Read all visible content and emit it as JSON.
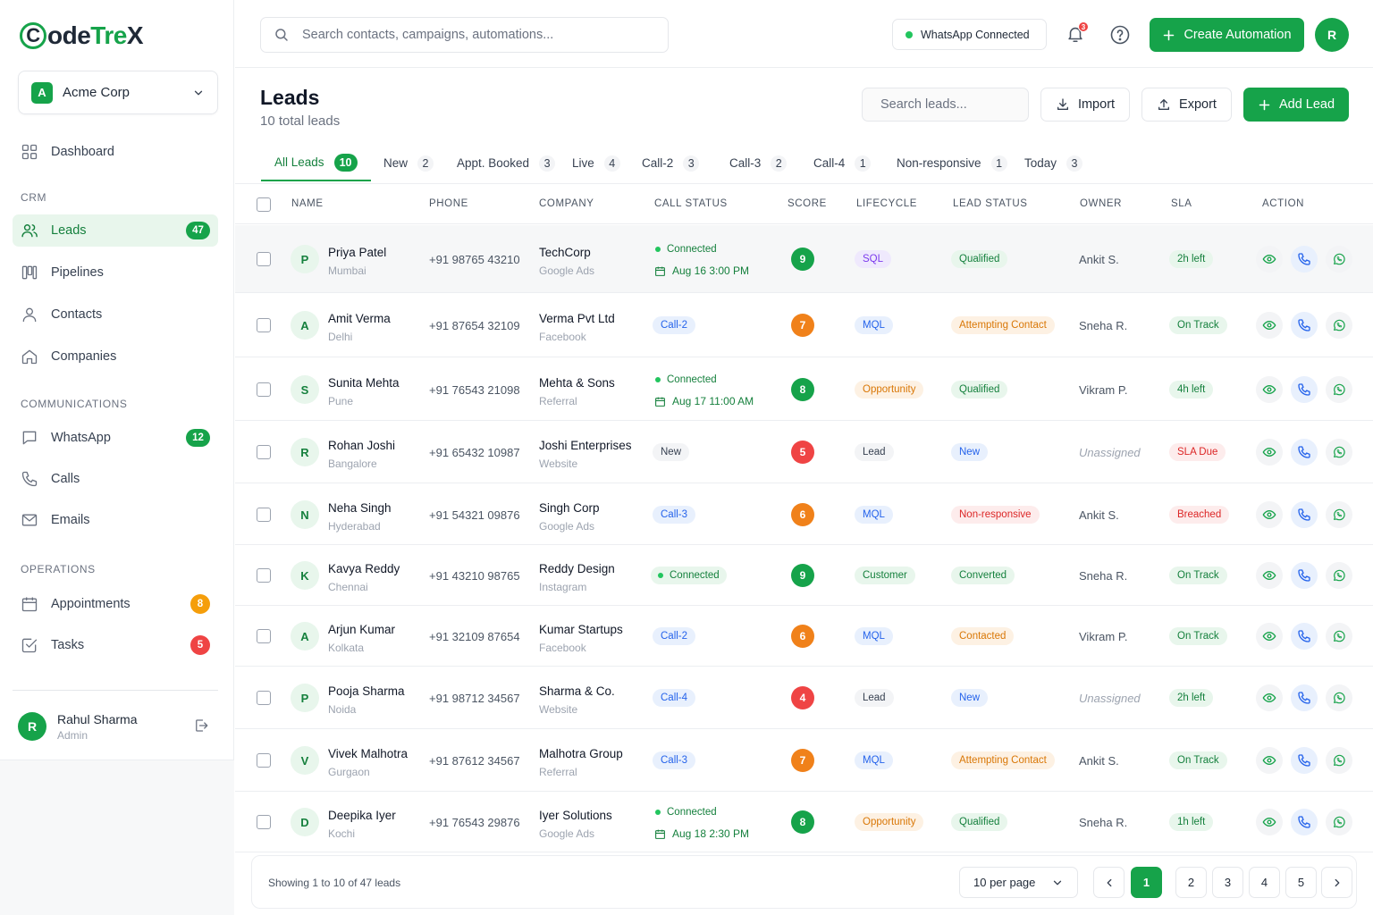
{
  "brand": {
    "part1": "ode",
    "part2": "Tre",
    "part3": "X",
    "ring_letter": "C"
  },
  "org": {
    "initial": "A",
    "name": "Acme Corp"
  },
  "nav": {
    "dashboard": "Dashboard",
    "crm_label": "CRM",
    "leads": "Leads",
    "leads_count": "47",
    "pipelines": "Pipelines",
    "contacts": "Contacts",
    "companies": "Companies",
    "comms_label": "COMMUNICATIONS",
    "whatsapp": "WhatsApp",
    "whatsapp_count": "12",
    "calls": "Calls",
    "emails": "Emails",
    "ops_label": "OPERATIONS",
    "appointments": "Appointments",
    "appointments_count": "8",
    "tasks": "Tasks",
    "tasks_count": "5"
  },
  "user": {
    "initial": "R",
    "name": "Rahul Sharma",
    "role": "Admin"
  },
  "topbar": {
    "search_placeholder": "Search contacts, campaigns, automations...",
    "whatsapp_status": "WhatsApp Connected",
    "notif_count": "3",
    "create_label": "Create Automation",
    "avatar_initial": "R"
  },
  "page": {
    "title": "Leads",
    "subtitle": "10 total leads",
    "search_placeholder": "Search leads...",
    "import_label": "Import",
    "export_label": "Export",
    "add_label": "Add Lead"
  },
  "tabs": [
    {
      "label": "All Leads",
      "count": "10"
    },
    {
      "label": "New",
      "count": "2"
    },
    {
      "label": "Appt. Booked",
      "count": "3"
    },
    {
      "label": "Live",
      "count": "4"
    },
    {
      "label": "Call-2",
      "count": "3"
    },
    {
      "label": "Call-3",
      "count": "2"
    },
    {
      "label": "Call-4",
      "count": "1"
    },
    {
      "label": "Non-responsive",
      "count": "1"
    },
    {
      "label": "Today",
      "count": "3"
    }
  ],
  "columns": [
    "NAME",
    "PHONE",
    "COMPANY",
    "CALL STATUS",
    "SCORE",
    "LIFECYCLE",
    "LEAD STATUS",
    "OWNER",
    "SLA",
    "ACTION"
  ],
  "leads": [
    {
      "initial": "P",
      "name": "Priya Patel",
      "city": "Mumbai",
      "phone": "+91 98765 43210",
      "company": "TechCorp",
      "source": "Google Ads",
      "call_status": "Connected",
      "call_kind": "connected",
      "appointment": "Aug 16 3:00 PM",
      "score": "9",
      "score_color": "green",
      "lifecycle": "SQL",
      "lifecycle_color": "purple",
      "lead_status": "Qualified",
      "lead_status_color": "green",
      "owner": "Ankit S.",
      "unassigned": false,
      "sla": "2h left",
      "sla_color": "green"
    },
    {
      "initial": "A",
      "name": "Amit Verma",
      "city": "Delhi",
      "phone": "+91 87654 32109",
      "company": "Verma Pvt Ltd",
      "source": "Facebook",
      "call_status": "Call-2",
      "call_kind": "blue",
      "appointment": "",
      "score": "7",
      "score_color": "orange",
      "lifecycle": "MQL",
      "lifecycle_color": "blue",
      "lead_status": "Attempting Contact",
      "lead_status_color": "orange",
      "owner": "Sneha R.",
      "unassigned": false,
      "sla": "On Track",
      "sla_color": "green"
    },
    {
      "initial": "S",
      "name": "Sunita Mehta",
      "city": "Pune",
      "phone": "+91 76543 21098",
      "company": "Mehta & Sons",
      "source": "Referral",
      "call_status": "Connected",
      "call_kind": "connected",
      "appointment": "Aug 17 11:00 AM",
      "score": "8",
      "score_color": "green",
      "lifecycle": "Opportunity",
      "lifecycle_color": "orange",
      "lead_status": "Qualified",
      "lead_status_color": "green",
      "owner": "Vikram P.",
      "unassigned": false,
      "sla": "4h left",
      "sla_color": "green"
    },
    {
      "initial": "R",
      "name": "Rohan Joshi",
      "city": "Bangalore",
      "phone": "+91 65432 10987",
      "company": "Joshi Enterprises",
      "source": "Website",
      "call_status": "New",
      "call_kind": "gray",
      "appointment": "",
      "score": "5",
      "score_color": "red",
      "lifecycle": "Lead",
      "lifecycle_color": "gray",
      "lead_status": "New",
      "lead_status_color": "blue",
      "owner": "Unassigned",
      "unassigned": true,
      "sla": "SLA Due",
      "sla_color": "red"
    },
    {
      "initial": "N",
      "name": "Neha Singh",
      "city": "Hyderabad",
      "phone": "+91 54321 09876",
      "company": "Singh Corp",
      "source": "Google Ads",
      "call_status": "Call-3",
      "call_kind": "blue",
      "appointment": "",
      "score": "6",
      "score_color": "orange",
      "lifecycle": "MQL",
      "lifecycle_color": "blue",
      "lead_status": "Non-responsive",
      "lead_status_color": "red",
      "owner": "Ankit S.",
      "unassigned": false,
      "sla": "Breached",
      "sla_color": "red"
    },
    {
      "initial": "K",
      "name": "Kavya Reddy",
      "city": "Chennai",
      "phone": "+91 43210 98765",
      "company": "Reddy Design",
      "source": "Instagram",
      "call_status": "Connected",
      "call_kind": "connected-pill",
      "appointment": "",
      "score": "9",
      "score_color": "green",
      "lifecycle": "Customer",
      "lifecycle_color": "green",
      "lead_status": "Converted",
      "lead_status_color": "green",
      "owner": "Sneha R.",
      "unassigned": false,
      "sla": "On Track",
      "sla_color": "green"
    },
    {
      "initial": "A",
      "name": "Arjun Kumar",
      "city": "Kolkata",
      "phone": "+91 32109 87654",
      "company": "Kumar Startups",
      "source": "Facebook",
      "call_status": "Call-2",
      "call_kind": "blue",
      "appointment": "",
      "score": "6",
      "score_color": "orange",
      "lifecycle": "MQL",
      "lifecycle_color": "blue",
      "lead_status": "Contacted",
      "lead_status_color": "orange",
      "owner": "Vikram P.",
      "unassigned": false,
      "sla": "On Track",
      "sla_color": "green"
    },
    {
      "initial": "P",
      "name": "Pooja Sharma",
      "city": "Noida",
      "phone": "+91 98712 34567",
      "company": "Sharma & Co.",
      "source": "Website",
      "call_status": "Call-4",
      "call_kind": "blue",
      "appointment": "",
      "score": "4",
      "score_color": "red",
      "lifecycle": "Lead",
      "lifecycle_color": "gray",
      "lead_status": "New",
      "lead_status_color": "blue",
      "owner": "Unassigned",
      "unassigned": true,
      "sla": "2h left",
      "sla_color": "green"
    },
    {
      "initial": "V",
      "name": "Vivek Malhotra",
      "city": "Gurgaon",
      "phone": "+91 87612 34567",
      "company": "Malhotra Group",
      "source": "Referral",
      "call_status": "Call-3",
      "call_kind": "blue",
      "appointment": "",
      "score": "7",
      "score_color": "orange",
      "lifecycle": "MQL",
      "lifecycle_color": "blue",
      "lead_status": "Attempting Contact",
      "lead_status_color": "orange",
      "owner": "Ankit S.",
      "unassigned": false,
      "sla": "On Track",
      "sla_color": "green"
    },
    {
      "initial": "D",
      "name": "Deepika Iyer",
      "city": "Kochi",
      "phone": "+91 76543 29876",
      "company": "Iyer Solutions",
      "source": "Google Ads",
      "call_status": "Connected",
      "call_kind": "connected",
      "appointment": "Aug 18 2:30 PM",
      "score": "8",
      "score_color": "green",
      "lifecycle": "Opportunity",
      "lifecycle_color": "orange",
      "lead_status": "Qualified",
      "lead_status_color": "green",
      "owner": "Sneha R.",
      "unassigned": false,
      "sla": "1h left",
      "sla_color": "green"
    }
  ],
  "footer": {
    "showing": "Showing 1 to 10 of 47 leads",
    "per_page": "10 per page",
    "pages": [
      "1",
      "2",
      "3",
      "4",
      "5"
    ],
    "current_page": "1"
  }
}
